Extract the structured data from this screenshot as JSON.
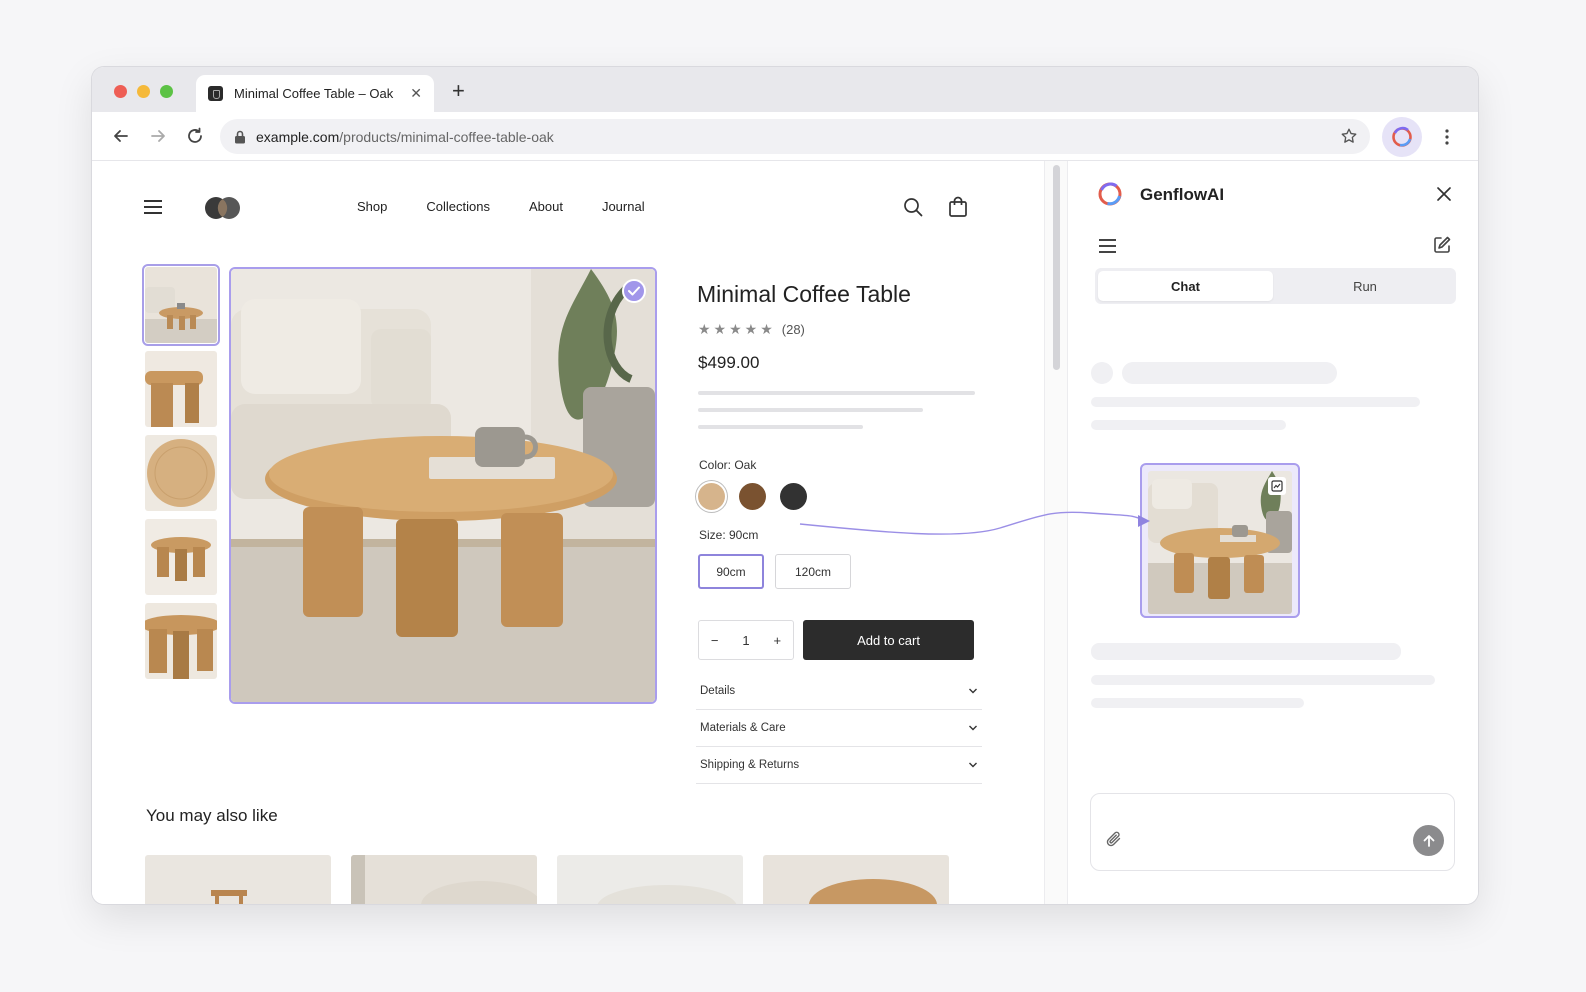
{
  "browser": {
    "tab_title": "Minimal Coffee Table – Oak",
    "url_host": "example.com",
    "url_path": "/products/minimal-coffee-table-oak"
  },
  "store": {
    "nav": [
      "Shop",
      "Collections",
      "About",
      "Journal"
    ],
    "product": {
      "title": "Minimal Coffee Table",
      "rating_count": "(28)",
      "rating_stars": 5,
      "price": "$499.00",
      "color_label": "Color: Oak",
      "colors": [
        "#d6b48c",
        "#7a5230",
        "#323232"
      ],
      "size_label": "Size: 90cm",
      "sizes": [
        "90cm",
        "120cm"
      ],
      "selected_size": "90cm",
      "quantity": "1",
      "add_to_cart": "Add to cart",
      "accordion": [
        "Details",
        "Materials & Care",
        "Shipping & Returns"
      ]
    },
    "related_title": "You may also like"
  },
  "assistant": {
    "name": "GenflowAI",
    "tabs": [
      "Chat",
      "Run"
    ],
    "active_tab": "Chat"
  },
  "colors": {
    "accent": "#a99ded",
    "dark_button": "#2c2c2c"
  }
}
